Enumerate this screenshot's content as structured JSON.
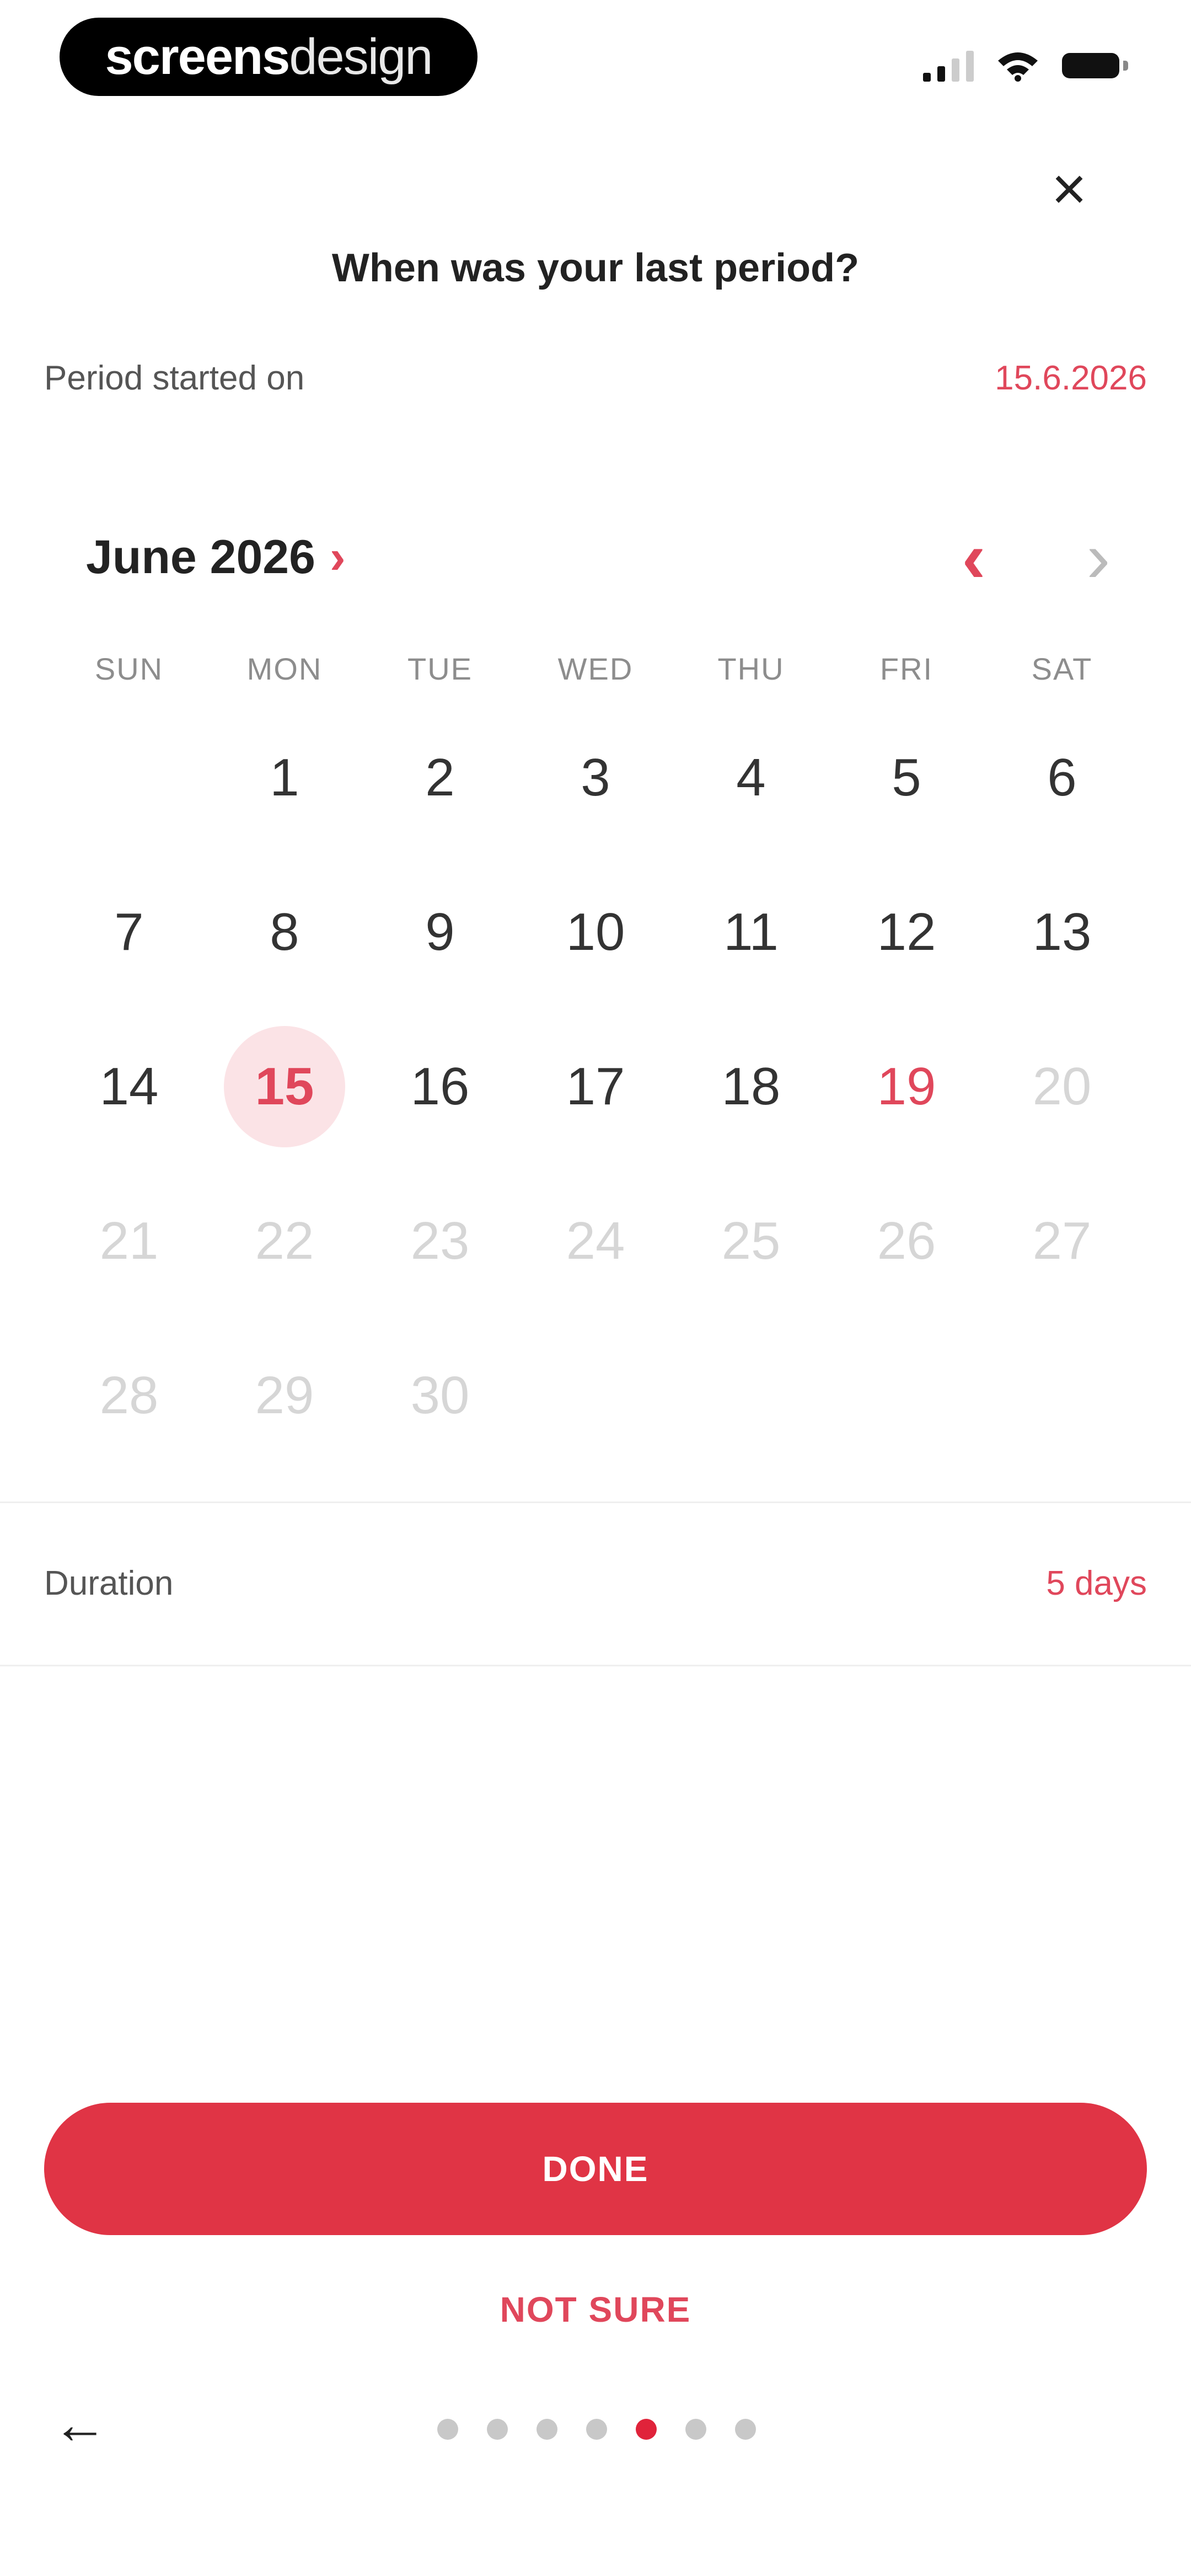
{
  "status_bar": {
    "brand_bold": "screens",
    "brand_light": "design",
    "icons": [
      "signal-icon",
      "wifi-icon",
      "battery-icon"
    ]
  },
  "header": {
    "close_icon": "close-icon",
    "close_glyph": "×",
    "question": "When was your last period?"
  },
  "period": {
    "label": "Period started on",
    "value": "15.6.2026"
  },
  "calendar": {
    "month_label": "June 2026",
    "month_chevron": "›",
    "prev_glyph": "‹",
    "next_glyph": "›",
    "weekdays": [
      "SUN",
      "MON",
      "TUE",
      "WED",
      "THU",
      "FRI",
      "SAT"
    ],
    "days": [
      "1",
      "2",
      "3",
      "4",
      "5",
      "6",
      "7",
      "8",
      "9",
      "10",
      "11",
      "12",
      "13",
      "14",
      "15",
      "16",
      "17",
      "18",
      "19",
      "20",
      "21",
      "22",
      "23",
      "24",
      "25",
      "26",
      "27",
      "28",
      "29",
      "30"
    ],
    "selected_day": 15,
    "today": 19,
    "last_enabled_day": 19
  },
  "duration": {
    "label": "Duration",
    "value": "5 days"
  },
  "actions": {
    "done_label": "DONE",
    "not_sure_label": "NOT SURE",
    "back_glyph": "←"
  },
  "pagination": {
    "total": 7,
    "active_index": 4
  },
  "colors": {
    "accent": "#e0475b",
    "button": "#e03445",
    "selected_bg": "#fbe3e6"
  }
}
